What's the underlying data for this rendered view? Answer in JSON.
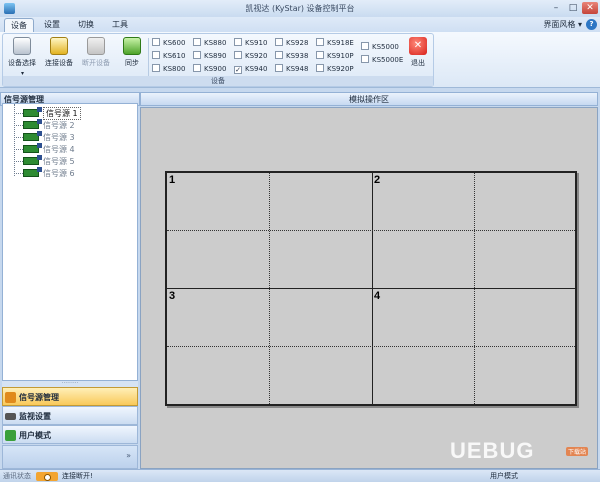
{
  "window": {
    "title": "凯视达 (KyStar) 设备控制平台"
  },
  "menu": {
    "tabs": [
      "设备",
      "设置",
      "切换",
      "工具"
    ],
    "active_tab": "设备",
    "style_label": "界面风格",
    "help_icon": "help-icon"
  },
  "ribbon": {
    "buttons": {
      "device_select": "设备选择",
      "connect": "连接设备",
      "disconnect": "断开设备",
      "sync": "同步",
      "exit": "退出"
    },
    "group_label": "设备",
    "models": [
      {
        "name": "KS600",
        "checked": false
      },
      {
        "name": "KS610",
        "checked": false
      },
      {
        "name": "KS800",
        "checked": false
      },
      {
        "name": "KS880",
        "checked": false
      },
      {
        "name": "KS890",
        "checked": false
      },
      {
        "name": "KS900",
        "checked": false
      },
      {
        "name": "KS910",
        "checked": false
      },
      {
        "name": "KS920",
        "checked": false
      },
      {
        "name": "KS940",
        "checked": true
      },
      {
        "name": "KS928",
        "checked": false
      },
      {
        "name": "KS938",
        "checked": false
      },
      {
        "name": "KS948",
        "checked": false
      },
      {
        "name": "KS918E",
        "checked": false
      },
      {
        "name": "KS910P",
        "checked": false
      },
      {
        "name": "KS920P",
        "checked": false
      },
      {
        "name": "KS5000",
        "checked": false
      },
      {
        "name": "KS5000E",
        "checked": false
      }
    ]
  },
  "left_panel": {
    "header": "信号源管理",
    "sources": [
      "信号源 1",
      "信号源 2",
      "信号源 3",
      "信号源 4",
      "信号源 5",
      "信号源 6"
    ],
    "selected_source": "信号源 1",
    "nav": [
      "信号源管理",
      "监视设置",
      "用户模式"
    ],
    "expand_glyph": "»",
    "splitter_glyph": "·········"
  },
  "sim": {
    "header": "模拟操作区",
    "windows": [
      "1",
      "2",
      "3",
      "4"
    ]
  },
  "status": {
    "label": "通讯状态",
    "connection": "连接断开!",
    "user_mode": "用户模式"
  },
  "watermark": {
    "text": "UEBUG",
    "sub": "下载站"
  }
}
